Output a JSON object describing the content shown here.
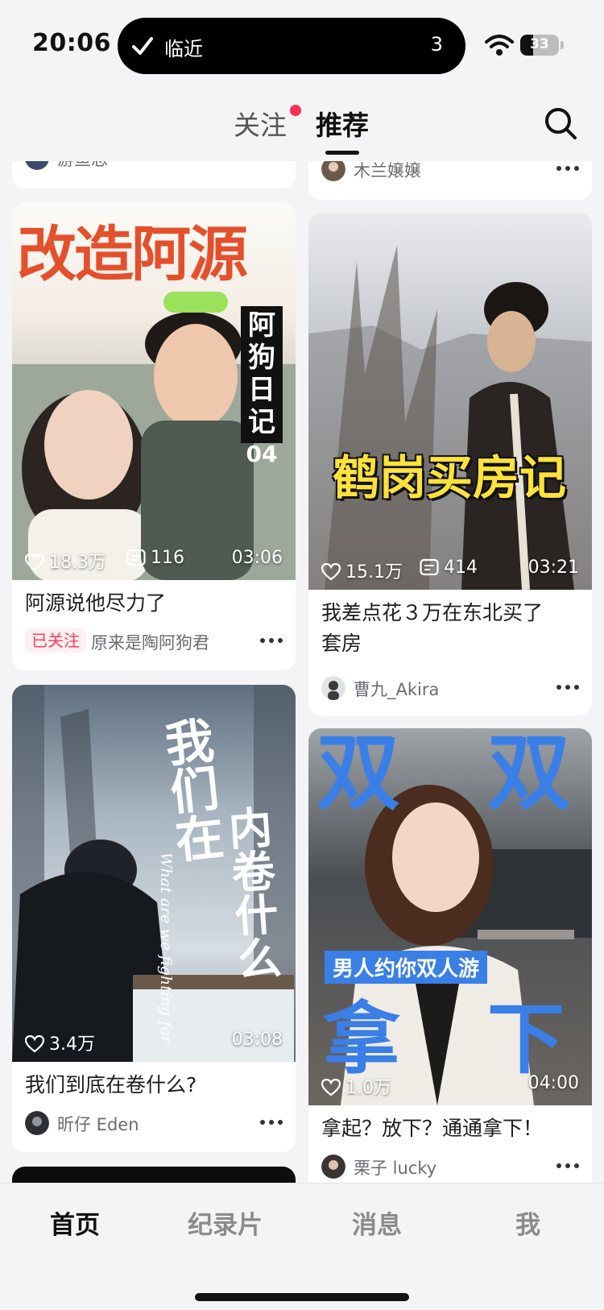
{
  "status_bar": {
    "time": "20:06",
    "island_label": "临近",
    "island_count": "3",
    "battery_level": "33",
    "battery_fraction": 0.33
  },
  "top_nav": {
    "follow_tab": "关注",
    "recommend_tab": "推荐",
    "active_tab": "推荐"
  },
  "feed": {
    "cards": [
      {
        "author": "游鱼忠"
      },
      {
        "author": "木兰嬢嬢"
      },
      {
        "thumb_title": "改造阿源",
        "thumb_side": [
          "阿",
          "狗",
          "日",
          "记",
          "04"
        ],
        "likes": "18.3万",
        "comments": "116",
        "duration": "03:06",
        "title": "阿源说他尽力了",
        "badge": "已关注",
        "author": "原来是陶阿狗君"
      },
      {
        "thumb_title": "鹤岗买房记",
        "likes": "15.1万",
        "comments": "414",
        "duration": "03:21",
        "title_lines": [
          "我差点花３万在东北买了",
          "套房"
        ],
        "author": "曹九_Akira"
      },
      {
        "thumb_left": "我们在",
        "thumb_right": "内卷什么",
        "thumb_script": "What are we fighting for",
        "likes": "3.4万",
        "duration": "03:08",
        "title": "我们到底在卷什么?",
        "author": "昕仔 Eden"
      },
      {
        "thumb_top": [
          "双",
          "双"
        ],
        "thumb_banner": "男人约你双人游",
        "thumb_bottom": [
          "拿",
          "下"
        ],
        "likes": "1.0万",
        "duration": "04:00",
        "title": "拿起？放下？通通拿下！",
        "author": "栗子 lucky"
      }
    ]
  },
  "bottom_tabs": [
    {
      "label": "首页",
      "active": true
    },
    {
      "label": "纪录片",
      "active": false
    },
    {
      "label": "消息",
      "active": false
    },
    {
      "label": "我",
      "active": false
    }
  ],
  "colors": {
    "accent_red": "#ff2d55",
    "followed_badge_text": "#ff3b5c",
    "thumb_title_orange": "#e4502b",
    "thumb_title_yellow": "#ffe23a",
    "thumb_blue": "#3a7fe6"
  },
  "icons": [
    "check-icon",
    "wifi-icon",
    "battery-icon",
    "search-icon",
    "heart-icon",
    "comment-icon",
    "more-icon"
  ]
}
